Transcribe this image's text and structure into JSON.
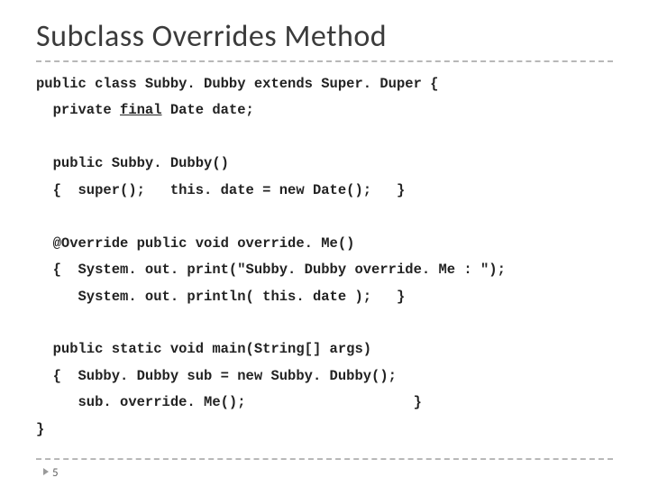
{
  "slide": {
    "title": "Subclass Overrides Method",
    "page_number": "5",
    "code": {
      "l1a": "public class Subby. Dubby extends Super. Duper {",
      "l2a": "  private ",
      "l2b": "final",
      "l2c": " Date date;",
      "l3": "",
      "l4": "  public Subby. Dubby()",
      "l5": "  {  super();   this. date = new Date();   }",
      "l6": "",
      "l7": "  @Override public void override. Me()",
      "l8": "  {  System. out. print(\"Subby. Dubby override. Me : \");",
      "l9": "     System. out. println( this. date );   }",
      "l10": "",
      "l11": "  public static void main(String[] args)",
      "l12": "  {  Subby. Dubby sub = new Subby. Dubby();",
      "l13": "     sub. override. Me();                    }",
      "l14": "}"
    }
  }
}
